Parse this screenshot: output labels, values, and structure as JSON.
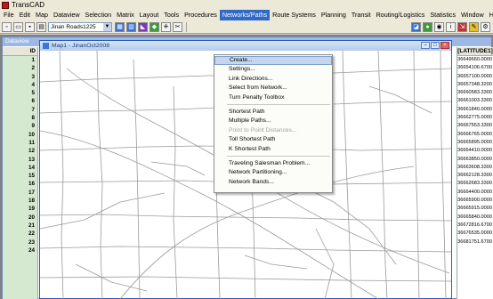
{
  "app": {
    "title": "TransCAD"
  },
  "menubar": {
    "items": [
      "File",
      "Edit",
      "Map",
      "Dataview",
      "Selection",
      "Matrix",
      "Layout",
      "Tools",
      "Procedures",
      "Networks/Paths",
      "Route Systems",
      "Planning",
      "Transit",
      "Routing/Logistics",
      "Statistics",
      "Window",
      "Help"
    ],
    "active": "Networks/Paths"
  },
  "toolbar": {
    "layer_select_value": "Jinan Roads1225"
  },
  "dataview": {
    "title": "Dataview",
    "id_header": "ID",
    "lat_header": "[LATITUDE1]",
    "ids": [
      "1",
      "2",
      "3",
      "4",
      "5",
      "6",
      "7",
      "8",
      "9",
      "10",
      "11",
      "12",
      "13",
      "14",
      "15",
      "16",
      "17",
      "18",
      "19",
      "20",
      "21",
      "22",
      "23",
      "24"
    ],
    "latitudes": [
      "36649660.0000",
      "36654106.6700",
      "36657100.0000",
      "36657348.3200",
      "36660583.3300",
      "36661003.3300",
      "36661840.0000",
      "36662775.0000",
      "36667553.3300",
      "36666765.0000",
      "36665895.0000",
      "36664410.0000",
      "36663850.0000",
      "36663608.3300",
      "36662128.3300",
      "36662683.3300",
      "36664400.0000",
      "36665900.0000",
      "36665915.0000",
      "36665840.0000",
      "36672816.6700",
      "36676535.0000",
      "36681751.6700"
    ]
  },
  "map_window": {
    "title": "Map1 - JinanOct2008"
  },
  "dropdown": {
    "groups": [
      [
        {
          "label": "Create...",
          "disabled": false
        },
        {
          "label": "Settings...",
          "disabled": false
        },
        {
          "label": "Link Directions...",
          "disabled": false
        },
        {
          "label": "Select from Network...",
          "disabled": false
        },
        {
          "label": "Turn Penalty Toolbox",
          "disabled": false
        }
      ],
      [
        {
          "label": "Shortest Path",
          "disabled": false
        },
        {
          "label": "Multiple Paths...",
          "disabled": false
        },
        {
          "label": "Point to Point Distances...",
          "disabled": true
        },
        {
          "label": "Toll Shortest Path",
          "disabled": false
        },
        {
          "label": "K Shortest Path",
          "disabled": false
        }
      ],
      [
        {
          "label": "Traveling Salesman Problem...",
          "disabled": false
        },
        {
          "label": "Network Partitioning...",
          "disabled": false
        },
        {
          "label": "Network Bands...",
          "disabled": false
        }
      ]
    ],
    "highlighted": "Create..."
  }
}
